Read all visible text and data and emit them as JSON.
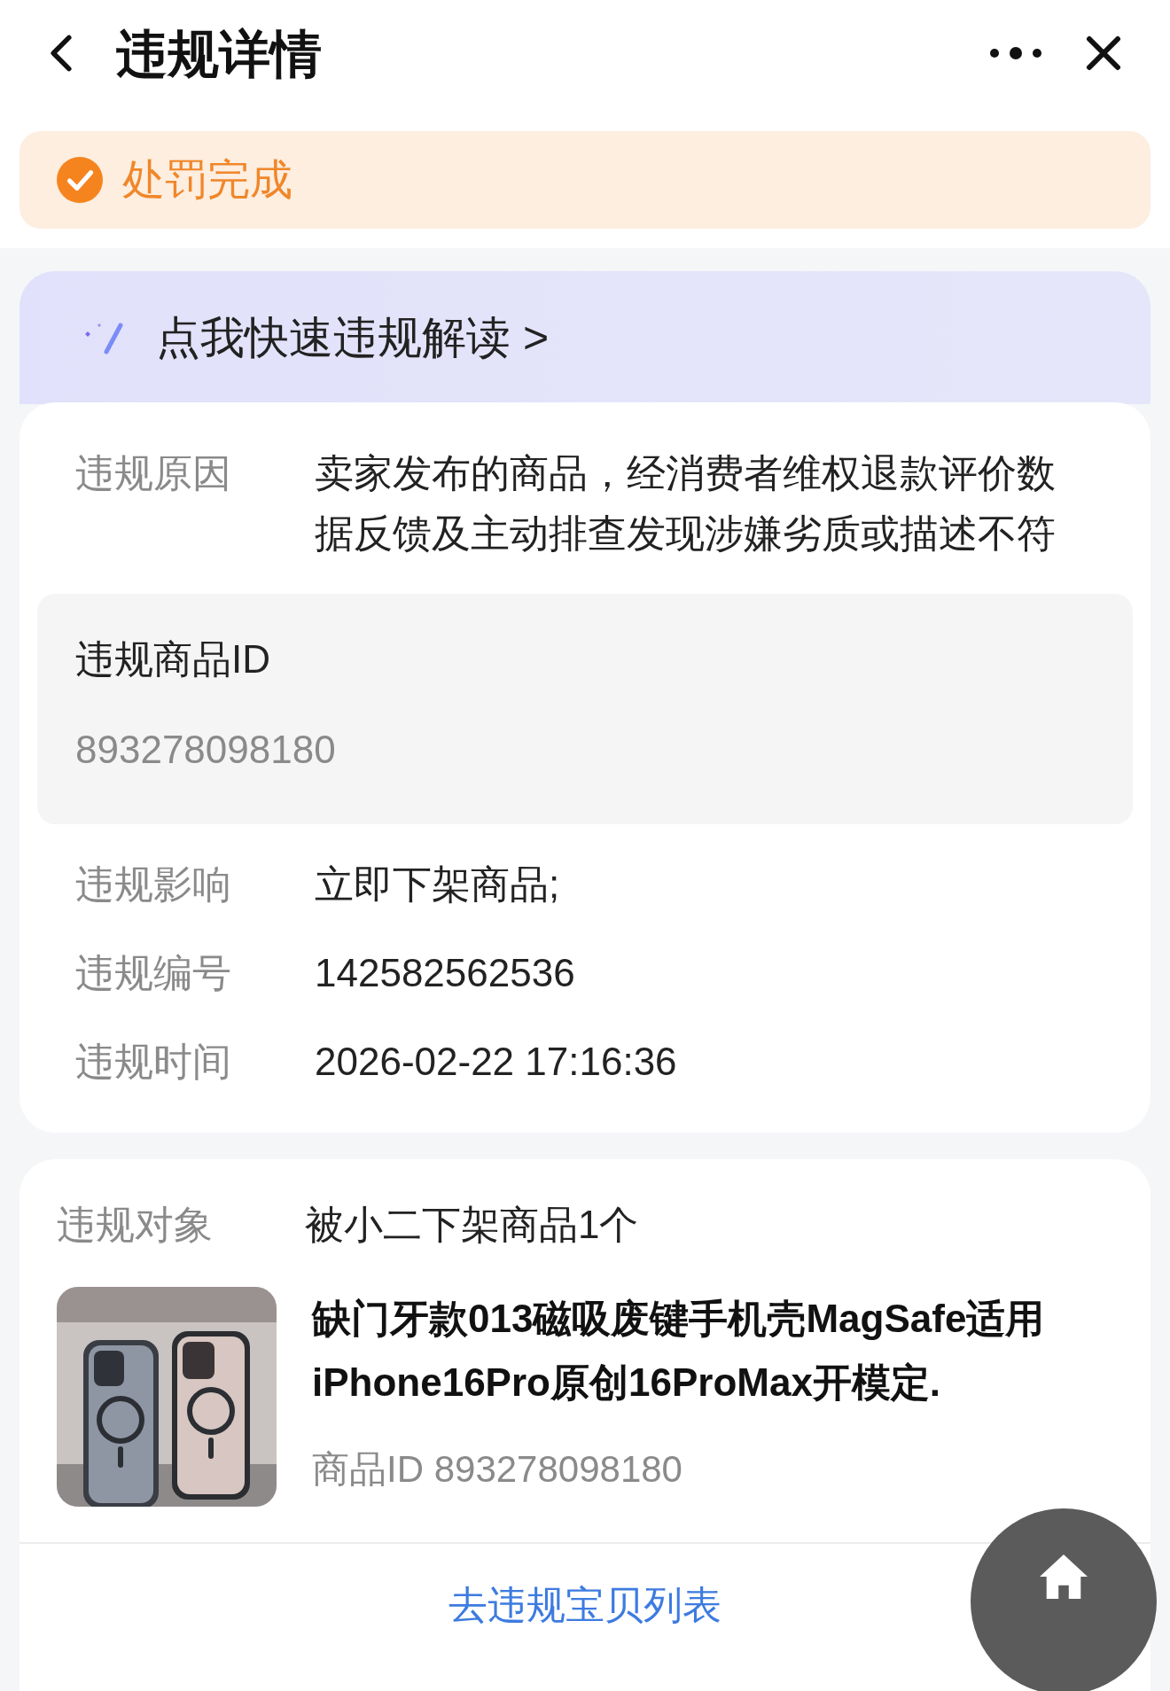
{
  "header": {
    "title": "违规详情"
  },
  "status": {
    "label": "处罚完成",
    "done": true
  },
  "ai_banner": {
    "label": "点我快速违规解读 >"
  },
  "details": [
    {
      "kind": "row",
      "label": "违规原因",
      "value": "卖家发布的商品，经消费者维权退款评价数据反馈及主动排查发现涉嫌劣质或描述不符"
    },
    {
      "kind": "block",
      "label": "违规商品ID",
      "value": "893278098180"
    },
    {
      "kind": "row",
      "label": "违规影响",
      "value": "立即下架商品;"
    },
    {
      "kind": "row",
      "label": "违规编号",
      "value": "142582562536"
    },
    {
      "kind": "row",
      "label": "违规时间",
      "value": "2026-02-22 17:16:36"
    }
  ],
  "target": {
    "label": "违规对象",
    "value": "被小二下架商品1个",
    "product": {
      "kind": "picture",
      "title": "缺门牙款013磁吸废键手机壳MagSafe适用iPhone16Pro原创16ProMax开模定.",
      "id": "商品ID 893278098180"
    },
    "link": "去违规宝贝列表"
  }
}
